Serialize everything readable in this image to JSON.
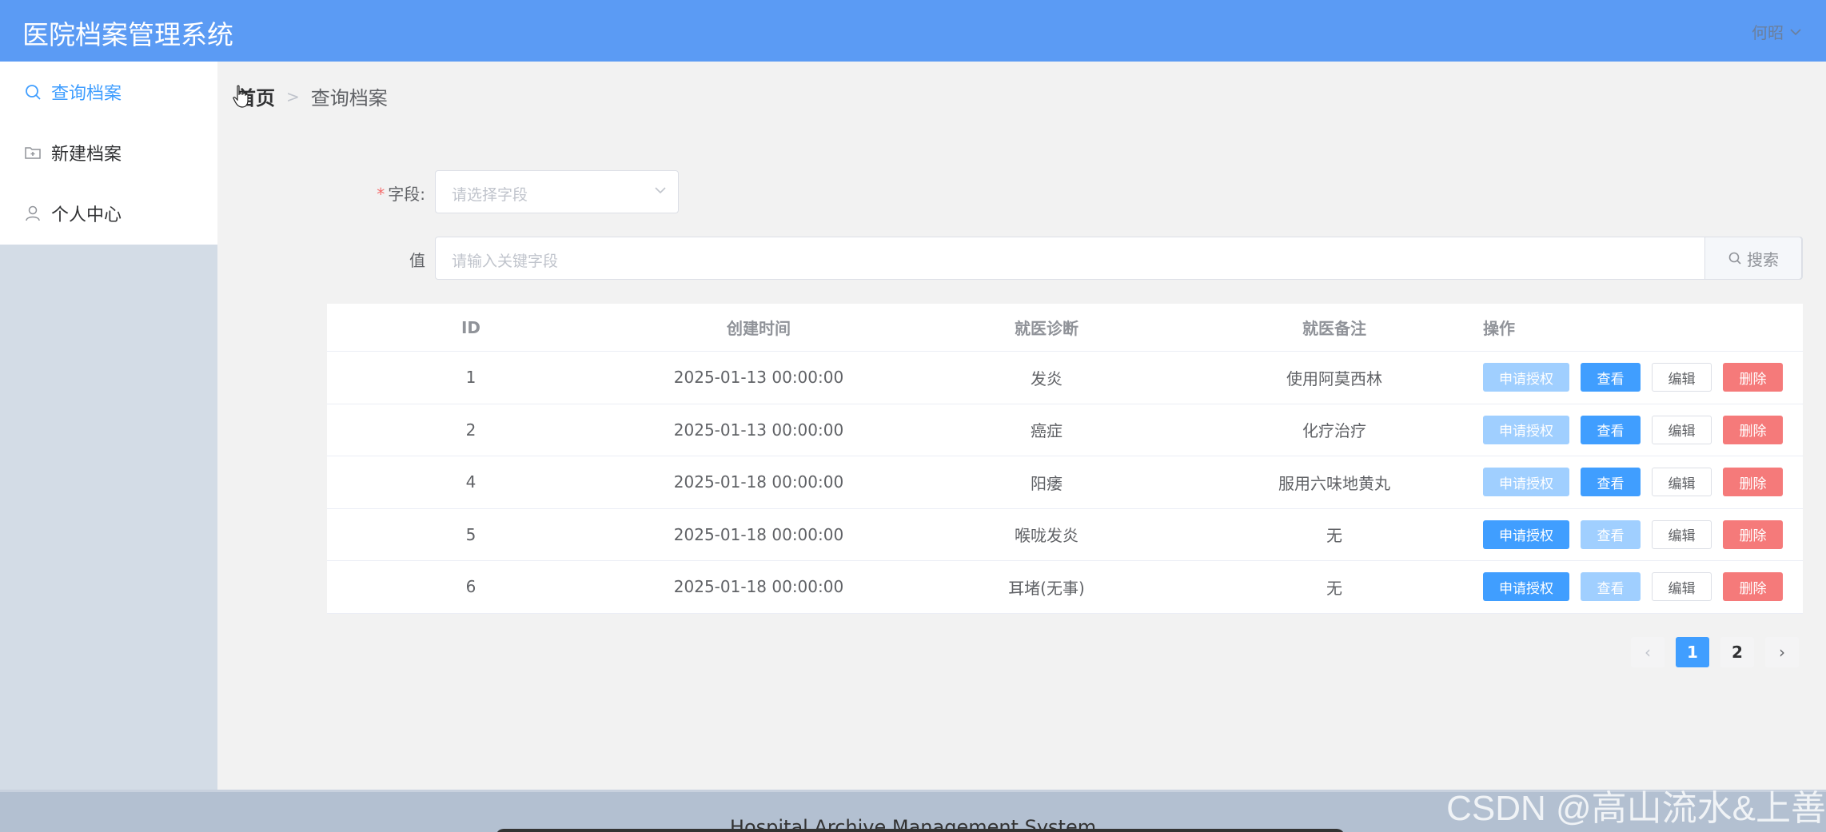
{
  "app": {
    "title": "医院档案管理系统",
    "user": "何昭"
  },
  "sidebar": {
    "items": [
      {
        "label": "查询档案",
        "icon": "search-icon",
        "active": true
      },
      {
        "label": "新建档案",
        "icon": "folder-add-icon",
        "active": false
      },
      {
        "label": "个人中心",
        "icon": "user-icon",
        "active": false
      }
    ]
  },
  "breadcrumb": {
    "home": "首页",
    "current": "查询档案"
  },
  "form": {
    "field_label": "字段:",
    "field_placeholder": "请选择字段",
    "value_label": "值",
    "value_placeholder": "请输入关键字段",
    "search_label": "搜索"
  },
  "table": {
    "headers": [
      "ID",
      "创建时间",
      "就医诊断",
      "就医备注",
      "操作"
    ],
    "rows": [
      {
        "id": "1",
        "time": "2025-01-13 00:00:00",
        "diagnosis": "发炎",
        "note": "使用阿莫西林",
        "apply_enabled": false,
        "view_enabled": true
      },
      {
        "id": "2",
        "time": "2025-01-13 00:00:00",
        "diagnosis": "癌症",
        "note": "化疗治疗",
        "apply_enabled": false,
        "view_enabled": true
      },
      {
        "id": "4",
        "time": "2025-01-18 00:00:00",
        "diagnosis": "阳痿",
        "note": "服用六味地黄丸",
        "apply_enabled": false,
        "view_enabled": true
      },
      {
        "id": "5",
        "time": "2025-01-18 00:00:00",
        "diagnosis": "喉咙发炎",
        "note": "无",
        "apply_enabled": true,
        "view_enabled": false
      },
      {
        "id": "6",
        "time": "2025-01-18 00:00:00",
        "diagnosis": "耳堵(无事)",
        "note": "无",
        "apply_enabled": true,
        "view_enabled": false
      }
    ],
    "actions": {
      "apply": "申请授权",
      "view": "查看",
      "edit": "编辑",
      "delete": "删除"
    }
  },
  "pagination": {
    "pages": [
      "1",
      "2"
    ],
    "current": "1",
    "prev": "‹",
    "next": "›"
  },
  "footer": {
    "text": "Hospital Archive Management System"
  },
  "watermark": "CSDN @高山流水&上善",
  "colors": {
    "header": "#5b9bf4",
    "primary": "#409eff",
    "danger": "#f56c6c",
    "sidebar": "#d3dce6"
  }
}
